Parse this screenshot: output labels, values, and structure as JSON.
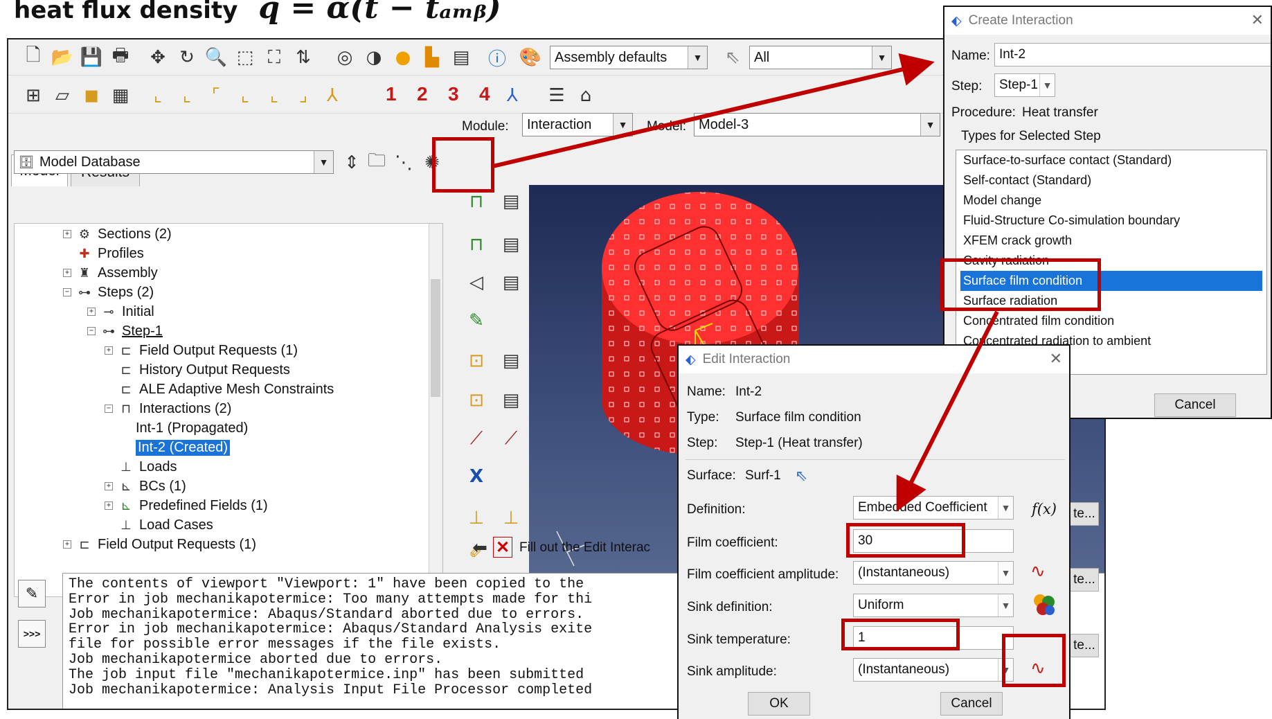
{
  "headline": {
    "prefix": "heat flux density",
    "formula": "q = α(t − tₐₘᵦ)"
  },
  "toolbar": {
    "render_style": "Assembly defaults",
    "selection_filter": "All",
    "view_numbers": [
      "1",
      "2",
      "3",
      "4"
    ]
  },
  "context": {
    "module_label": "Module:",
    "module_value": "Interaction",
    "model_label": "Model:",
    "model_value": "Model-3"
  },
  "tabs": [
    "Model",
    "Results"
  ],
  "tree_header": "Model Database",
  "tree": [
    {
      "label": "Sections (2)",
      "icon": "sections-icon",
      "expander": "+"
    },
    {
      "label": "Profiles",
      "icon": "profiles-icon",
      "expander": ""
    },
    {
      "label": "Assembly",
      "icon": "assembly-icon",
      "expander": "+"
    },
    {
      "label": "Steps (2)",
      "icon": "steps-icon",
      "expander": "−"
    },
    {
      "label": "Initial",
      "icon": "step-initial-icon",
      "expander": "+"
    },
    {
      "label": "Step-1",
      "icon": "step-icon",
      "expander": "−"
    },
    {
      "label": "Field Output Requests (1)",
      "icon": "field-output-icon",
      "expander": "+"
    },
    {
      "label": "History Output Requests",
      "icon": "history-output-icon",
      "expander": ""
    },
    {
      "label": "ALE Adaptive Mesh Constraints",
      "icon": "ale-mesh-icon",
      "expander": ""
    },
    {
      "label": "Interactions (2)",
      "icon": "interactions-icon",
      "expander": "−"
    },
    {
      "label": "Int-1 (Propagated)",
      "icon": "",
      "expander": ""
    },
    {
      "label": "Int-2 (Created)",
      "icon": "",
      "expander": ""
    },
    {
      "label": "Loads",
      "icon": "loads-icon",
      "expander": ""
    },
    {
      "label": "BCs (1)",
      "icon": "bcs-icon",
      "expander": "+"
    },
    {
      "label": "Predefined Fields (1)",
      "icon": "predefined-fields-icon",
      "expander": "+"
    },
    {
      "label": "Load Cases",
      "icon": "load-cases-icon",
      "expander": ""
    },
    {
      "label": "Field Output Requests (1)",
      "icon": "field-output-icon",
      "expander": "+"
    }
  ],
  "prompt": "Fill out the Edit Interac",
  "messages": [
    "The contents of viewport \"Viewport: 1\" have been copied to the",
    "Error in job mechanikapotermice: Too many attempts made for thi",
    "Job mechanikapotermice: Abaqus/Standard aborted due to errors.",
    "Error in job mechanikapotermice: Abaqus/Standard Analysis exite",
    "file for possible error messages if the file exists.",
    "Job mechanikapotermice aborted due to errors.",
    "The job input file \"mechanikapotermice.inp\" has been submitted",
    "Job mechanikapotermice: Analysis Input File Processor completed"
  ],
  "command_button": ">>>",
  "create_dialog": {
    "title": "Create Interaction",
    "name_label": "Name:",
    "name_value": "Int-2",
    "step_label": "Step:",
    "step_value": "Step-1",
    "procedure_label": "Procedure:",
    "procedure_value": "Heat transfer",
    "group_label": "Types for Selected Step",
    "types": [
      "Surface-to-surface contact (Standard)",
      "Self-contact (Standard)",
      "Model change",
      "Fluid-Structure Co-simulation boundary",
      "XFEM crack growth",
      "Cavity radiation",
      "Surface film condition",
      "Surface radiation",
      "Concentrated film condition",
      "Concentrated radiation to ambient"
    ],
    "selected_type": "Surface film condition",
    "cancel": "Cancel"
  },
  "edit_dialog": {
    "title": "Edit Interaction",
    "name_label": "Name:",
    "name_value": "Int-2",
    "type_label": "Type:",
    "type_value": "Surface film condition",
    "step_label": "Step:",
    "step_value": "Step-1 (Heat transfer)",
    "surface_label": "Surface:",
    "surface_value": "Surf-1",
    "definition_label": "Definition:",
    "definition_value": "Embedded Coefficient",
    "film_label": "Film coefficient:",
    "film_value": "30",
    "film_amp_label": "Film coefficient amplitude:",
    "film_amp_value": "(Instantaneous)",
    "sink_def_label": "Sink definition:",
    "sink_def_value": "Uniform",
    "sink_temp_label": "Sink temperature:",
    "sink_temp_value": "1",
    "sink_amp_label": "Sink amplitude:",
    "sink_amp_value": "(Instantaneous)",
    "ok": "OK",
    "cancel": "Cancel",
    "fx": "f(x)"
  },
  "behind_buttons": [
    "te...",
    "te...",
    "te..."
  ],
  "colors": {
    "highlight": "#c00000",
    "selection": "#1a73d8",
    "mesh_red": "#ff2a2a"
  }
}
